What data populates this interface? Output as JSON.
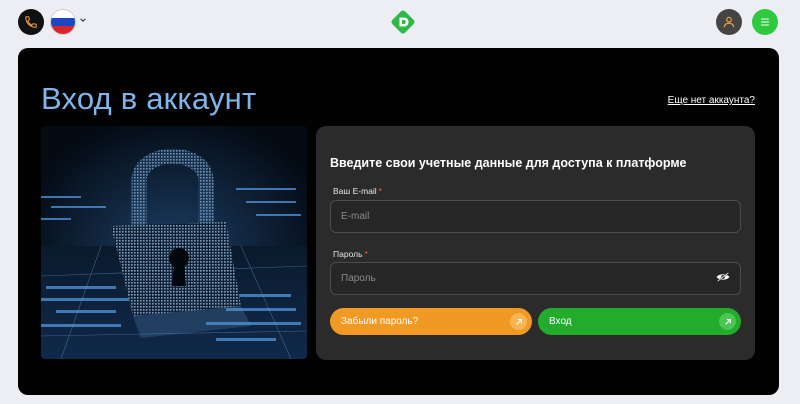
{
  "header": {
    "phone_icon": "phone-icon",
    "language": {
      "flag": "flag-ru-icon",
      "colors": [
        "#ffffff",
        "#1c46c4",
        "#d6262b"
      ]
    },
    "logo_icon": "d-logo-icon",
    "user_icon": "user-icon",
    "menu_icon": "menu-icon"
  },
  "page": {
    "title": "Вход в аккаунт",
    "signup_link": "Еще нет аккаунта?"
  },
  "form": {
    "heading": "Введите свои учетные данные для доступа к платформе",
    "email": {
      "label": "Ваш E-mail",
      "required": "*",
      "placeholder": "E-mail",
      "value": ""
    },
    "password": {
      "label": "Пароль",
      "required": "*",
      "placeholder": "Пароль",
      "value": "",
      "toggle_icon": "eye-hidden-icon"
    },
    "forgot_button": {
      "label": "Забыли пароль?",
      "icon": "arrow-up-right-icon"
    },
    "login_button": {
      "label": "Вход",
      "icon": "arrow-up-right-icon"
    }
  },
  "colors": {
    "accent_blue": "#7fb4ec",
    "orange": "#f09a24",
    "green": "#23ab2b",
    "menu_green": "#2fc940"
  }
}
